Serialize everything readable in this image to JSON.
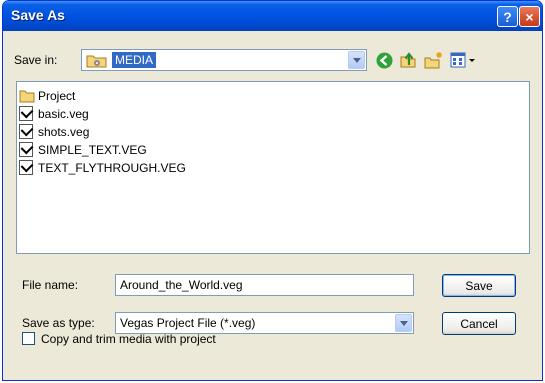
{
  "window": {
    "title": "Save As"
  },
  "titlebar": {
    "help_label": "?",
    "close_label": "×"
  },
  "save_in": {
    "label": "Save in:",
    "value": "MEDIA"
  },
  "files": [
    {
      "name": "Project",
      "type": "folder"
    },
    {
      "name": "basic.veg",
      "type": "veg"
    },
    {
      "name": "shots.veg",
      "type": "veg"
    },
    {
      "name": "SIMPLE_TEXT.VEG",
      "type": "veg"
    },
    {
      "name": "TEXT_FLYTHROUGH.VEG",
      "type": "veg"
    }
  ],
  "file_name": {
    "label": "File name:",
    "value": "Around_the_World.veg"
  },
  "save_as_type": {
    "label": "Save as type:",
    "value": "Vegas Project File (*.veg)"
  },
  "buttons": {
    "save": "Save",
    "cancel": "Cancel"
  },
  "copy_trim": {
    "label": "Copy and trim media with project",
    "checked": false
  },
  "colors": {
    "titlebar": "#0054e3",
    "selection": "#316ac5",
    "dialog_bg": "#ece9d8"
  }
}
